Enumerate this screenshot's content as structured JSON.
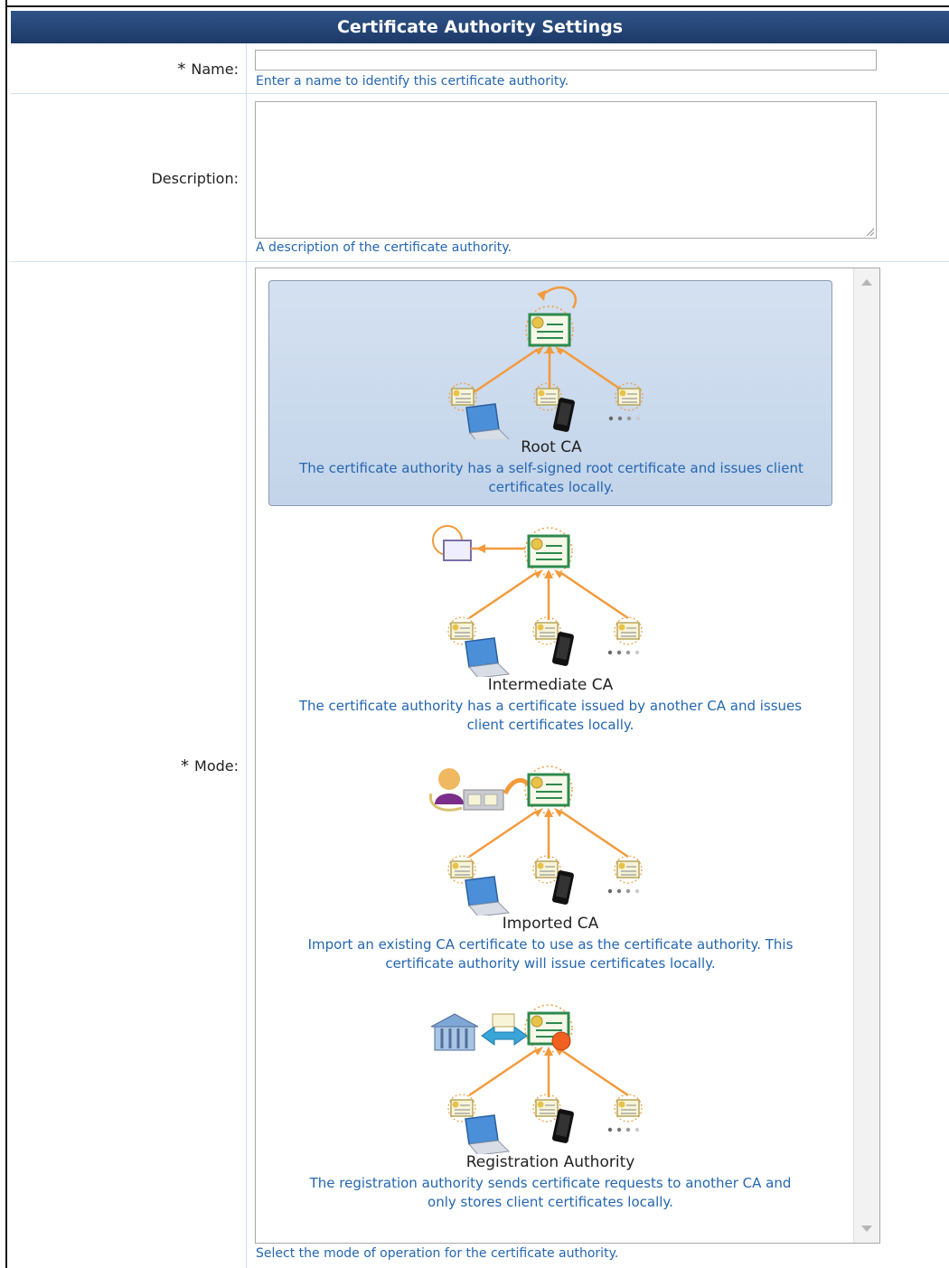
{
  "header": {
    "title": "Certificate Authority Settings"
  },
  "name_field": {
    "label": "Name:",
    "required_mark": "*",
    "value": "",
    "hint": "Enter a name to identify this certificate authority."
  },
  "description_field": {
    "label": "Description:",
    "value": "",
    "hint": "A description of the certificate authority."
  },
  "mode_field": {
    "label": "Mode:",
    "required_mark": "*",
    "hint": "Select the mode of operation for the certificate authority.",
    "selected": "Root CA",
    "options": [
      {
        "title": "Root CA",
        "description_line1": "The certificate authority has a self-signed root certificate and issues client",
        "description_line2": "certificates locally."
      },
      {
        "title": "Intermediate CA",
        "description_line1": "The certificate authority has a certificate issued by another CA and issues",
        "description_line2": "client certificates locally."
      },
      {
        "title": "Imported CA",
        "description_line1": "Import an existing CA certificate to use as the certificate authority. This",
        "description_line2": "certificate authority will issue certificates locally."
      },
      {
        "title": "Registration Authority",
        "description_line1": "The registration authority sends certificate requests to another CA and",
        "description_line2": "only stores client certificates locally."
      }
    ]
  },
  "colors": {
    "header_bg": "#1d3a68",
    "hint_text": "#2466b0",
    "selected_bg": "#c3d4ea",
    "arrow": "#f39a3c",
    "cert_border": "#2d8a4e"
  },
  "icons": {
    "certificate": "certificate-icon",
    "laptop": "laptop-icon",
    "phone": "phone-icon",
    "user": "user-icon",
    "bank": "bank-icon"
  }
}
